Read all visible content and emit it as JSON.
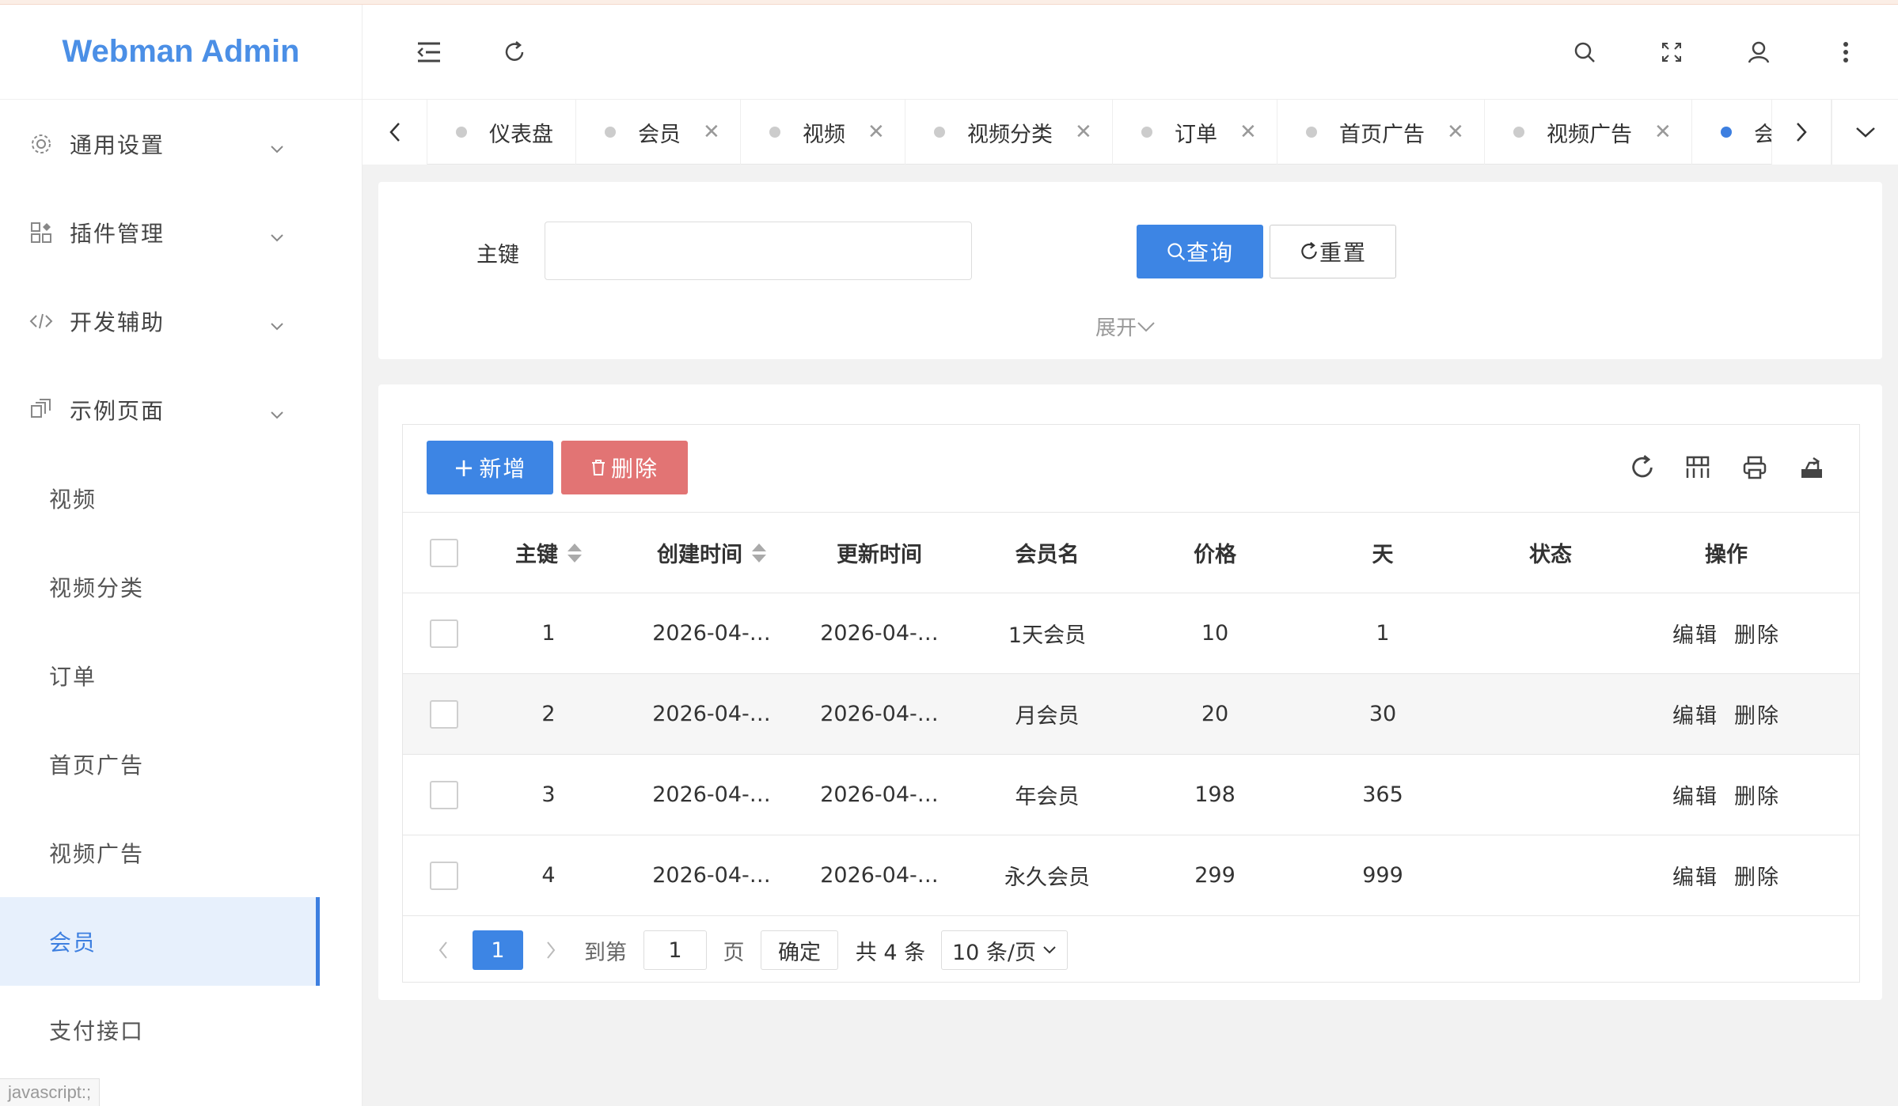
{
  "app": {
    "title": "Webman Admin"
  },
  "sidebar": {
    "groups": [
      {
        "label": "通用设置",
        "icon": "gear-icon"
      },
      {
        "label": "插件管理",
        "icon": "apps-icon"
      },
      {
        "label": "开发辅助",
        "icon": "code-icon"
      },
      {
        "label": "示例页面",
        "icon": "pages-icon"
      }
    ],
    "items": [
      {
        "label": "视频",
        "active": false
      },
      {
        "label": "视频分类",
        "active": false
      },
      {
        "label": "订单",
        "active": false
      },
      {
        "label": "首页广告",
        "active": false
      },
      {
        "label": "视频广告",
        "active": false
      },
      {
        "label": "会员",
        "active": true
      },
      {
        "label": "支付接口",
        "active": false
      }
    ],
    "status_hint": "javascript:;"
  },
  "header": {
    "icons": [
      "menu-fold-icon",
      "refresh-icon",
      "search-icon",
      "fullscreen-icon",
      "user-icon",
      "more-icon"
    ]
  },
  "tabs": [
    {
      "label": "仪表盘",
      "closable": false
    },
    {
      "label": "会员",
      "closable": true
    },
    {
      "label": "视频",
      "closable": true
    },
    {
      "label": "视频分类",
      "closable": true
    },
    {
      "label": "订单",
      "closable": true
    },
    {
      "label": "首页广告",
      "closable": true
    },
    {
      "label": "视频广告",
      "closable": true
    },
    {
      "label": "会",
      "closable": false,
      "active": true
    }
  ],
  "search": {
    "key_label": "主键",
    "key_value": "",
    "query_label": "查询",
    "reset_label": "重置",
    "expand_label": "展开"
  },
  "toolbar": {
    "add_label": "新增",
    "delete_label": "删除"
  },
  "table": {
    "columns": [
      "主键",
      "创建时间",
      "更新时间",
      "会员名",
      "价格",
      "天",
      "状态",
      "操作"
    ],
    "rows": [
      {
        "id": "1",
        "created": "2026-04-…",
        "updated": "2026-04-…",
        "name": "1天会员",
        "price": "10",
        "days": "1",
        "status": ""
      },
      {
        "id": "2",
        "created": "2026-04-…",
        "updated": "2026-04-…",
        "name": "月会员",
        "price": "20",
        "days": "30",
        "status": ""
      },
      {
        "id": "3",
        "created": "2026-04-…",
        "updated": "2026-04-…",
        "name": "年会员",
        "price": "198",
        "days": "365",
        "status": ""
      },
      {
        "id": "4",
        "created": "2026-04-…",
        "updated": "2026-04-…",
        "name": "永久会员",
        "price": "299",
        "days": "999",
        "status": ""
      }
    ],
    "row_edit_label": "编辑",
    "row_delete_label": "删除"
  },
  "pager": {
    "current": "1",
    "goto_label": "到第",
    "goto_value": "1",
    "page_unit": "页",
    "confirm_label": "确定",
    "total_label": "共 4 条",
    "page_size": "10 条/页"
  }
}
